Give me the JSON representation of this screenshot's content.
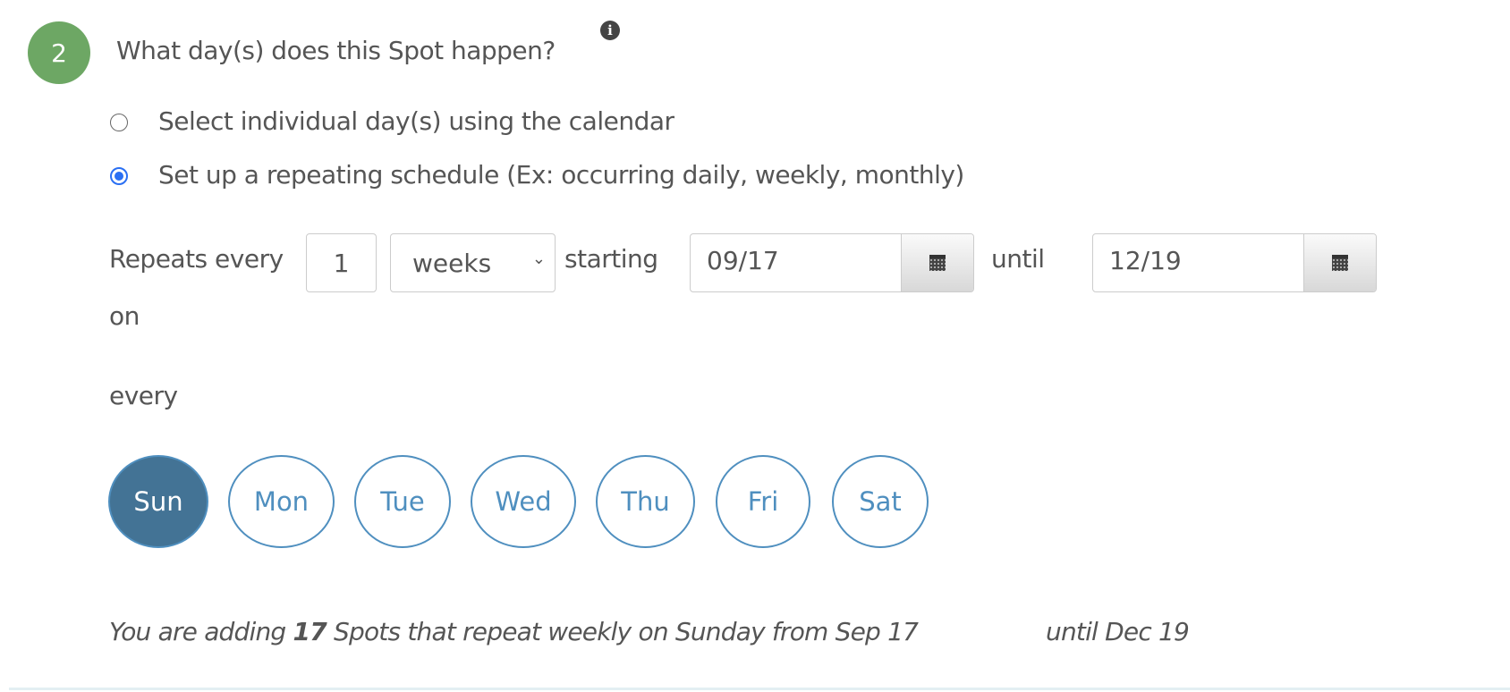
{
  "step": {
    "number": "2",
    "title": "What day(s) does this Spot happen?",
    "info_icon": "info-circle-icon"
  },
  "options": [
    {
      "label": "Select individual day(s) using the calendar",
      "selected": false
    },
    {
      "label": "Set up a repeating schedule (Ex: occurring daily, weekly, monthly)",
      "selected": true
    }
  ],
  "repeat": {
    "label": "Repeats every",
    "interval": "1",
    "unit": "weeks",
    "starting_label": "starting",
    "start_date": "09/17",
    "until_label": "until",
    "end_date": "12/19",
    "on_label": "on",
    "every_label": "every"
  },
  "days": [
    {
      "label": "Sun",
      "selected": true
    },
    {
      "label": "Mon",
      "selected": false
    },
    {
      "label": "Tue",
      "selected": false
    },
    {
      "label": "Wed",
      "selected": false
    },
    {
      "label": "Thu",
      "selected": false
    },
    {
      "label": "Fri",
      "selected": false
    },
    {
      "label": "Sat",
      "selected": false
    }
  ],
  "summary": {
    "prefix": "You are adding ",
    "count": "17",
    "middle": " Spots that repeat weekly on Sunday from Sep 17",
    "suffix": "until Dec 19"
  },
  "colors": {
    "step": "#6da764",
    "day_selected": "#437395",
    "day_border": "#4f8fbf",
    "radio": "#2a6ff3"
  }
}
